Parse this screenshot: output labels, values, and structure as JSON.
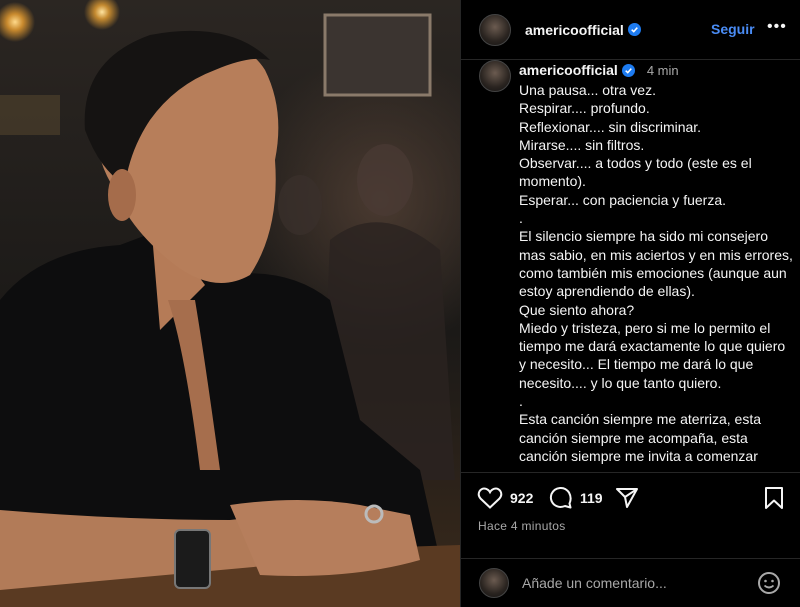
{
  "post": {
    "username": "americoofficial",
    "follow_label": "Seguir",
    "more_label": "•••",
    "caption_time": "4 min",
    "caption_lines": [
      "Una pausa... otra vez.",
      "Respirar.... profundo.",
      "Reflexionar.... sin discriminar.",
      "Mirarse.... sin filtros.",
      "Observar.... a todos y todo (este es el momento).",
      "Esperar... con paciencia y fuerza.",
      ".",
      "El silencio siempre ha sido mi consejero mas sabio, en mis aciertos y en mis errores, como también mis emociones (aunque aun estoy aprendiendo de ellas).",
      "Que siento ahora?",
      "Miedo y tristeza, pero si me lo permito el tiempo me dará exactamente lo que quiero y necesito... El tiempo me dará lo que necesito.... y lo que tanto quiero.",
      ".",
      "Esta canción siempre me aterriza, esta canción siempre me acompaña, esta canción siempre me invita a comenzar"
    ],
    "likes": "922",
    "comments": "119",
    "time_ago": "Hace 4 minutos",
    "comment_placeholder": "Añade un comentario..."
  },
  "colors": {
    "accent": "#4a8cf5",
    "verified": "#1d7bf0",
    "muted": "#a8a8a8",
    "border": "#262626"
  },
  "icons": [
    "verified-badge-icon",
    "heart-icon",
    "comment-icon",
    "share-icon",
    "bookmark-icon",
    "emoji-icon"
  ]
}
